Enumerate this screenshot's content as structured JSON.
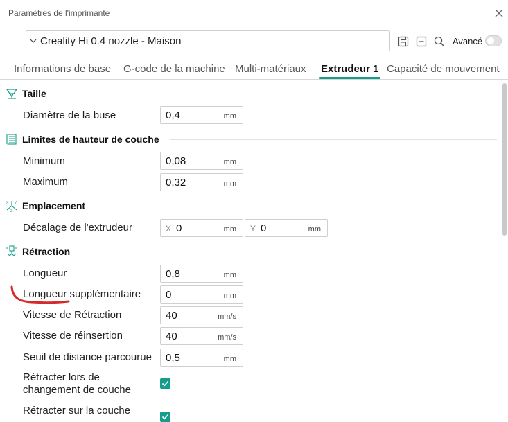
{
  "window": {
    "title": "Paramètres de l'imprimante"
  },
  "preset": {
    "selected": "Creality Hi 0.4 nozzle - Maison"
  },
  "toolbar": {
    "advanced_label": "Avancé",
    "advanced_on": false
  },
  "tabs": [
    {
      "label": "Informations de base",
      "active": false
    },
    {
      "label": "G-code de la machine",
      "active": false
    },
    {
      "label": "Multi-matériaux",
      "active": false
    },
    {
      "label": "Extrudeur 1",
      "active": true
    },
    {
      "label": "Capacité de mouvement",
      "active": false
    }
  ],
  "accent_color": "#169c8a",
  "annotation_color": "#d42a2a",
  "sections": {
    "taille": {
      "title": "Taille",
      "icon": "nozzle-icon",
      "diametre": {
        "label": "Diamètre de la buse",
        "value": "0,4",
        "unit": "mm"
      }
    },
    "limites": {
      "title": "Limites de hauteur de couche",
      "icon": "layers-icon",
      "minimum": {
        "label": "Minimum",
        "value": "0,08",
        "unit": "mm"
      },
      "maximum": {
        "label": "Maximum",
        "value": "0,32",
        "unit": "mm"
      }
    },
    "emplacement": {
      "title": "Emplacement",
      "icon": "xyz-axes-icon",
      "decalage": {
        "label": "Décalage de l'extrudeur",
        "x_axis": "X",
        "x_value": "0",
        "y_axis": "Y",
        "y_value": "0",
        "unit": "mm"
      }
    },
    "retraction": {
      "title": "Rétraction",
      "icon": "retraction-icon",
      "longueur": {
        "label": "Longueur",
        "value": "0,8",
        "unit": "mm"
      },
      "longueur_supp": {
        "label": "Longueur supplémentaire",
        "value": "0",
        "unit": "mm"
      },
      "vitesse_retraction": {
        "label": "Vitesse de Rétraction",
        "value": "40",
        "unit": "mm/s"
      },
      "vitesse_reinsertion": {
        "label": "Vitesse de réinsertion",
        "value": "40",
        "unit": "mm/s"
      },
      "seuil": {
        "label": "Seuil de distance parcourue",
        "value": "0,5",
        "unit": "mm"
      },
      "retracter_changement": {
        "label_line1": "Rétracter lors de",
        "label_line2": "changement de couche",
        "checked": true
      },
      "retracter_couche": {
        "label": "Rétracter sur la couche",
        "checked": true
      }
    }
  }
}
